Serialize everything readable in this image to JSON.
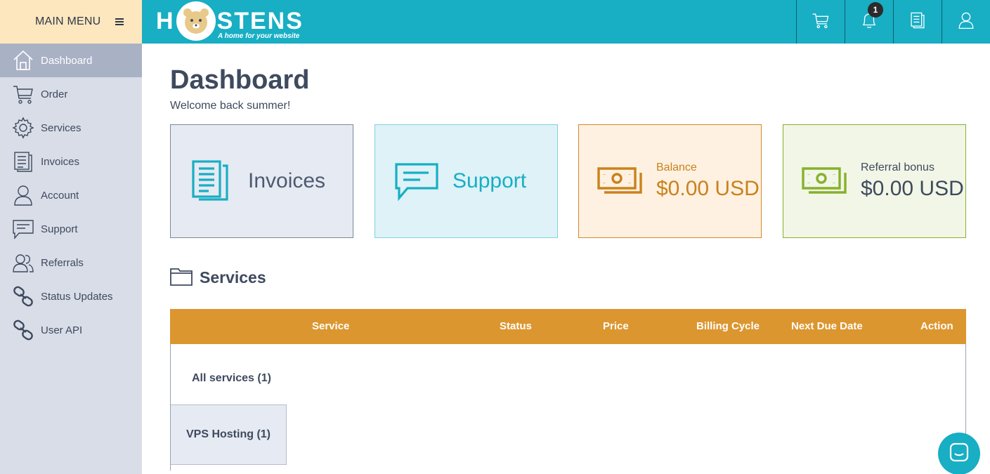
{
  "sidebar": {
    "menu_title": "MAIN MENU",
    "items": [
      {
        "label": "Dashboard",
        "icon": "home-icon",
        "active": true
      },
      {
        "label": "Order",
        "icon": "cart-icon"
      },
      {
        "label": "Services",
        "icon": "gear-icon"
      },
      {
        "label": "Invoices",
        "icon": "invoice-icon"
      },
      {
        "label": "Account",
        "icon": "user-icon"
      },
      {
        "label": "Support",
        "icon": "chat-icon"
      },
      {
        "label": "Referrals",
        "icon": "users-icon"
      },
      {
        "label": "Status Updates",
        "icon": "link-icon"
      },
      {
        "label": "User API",
        "icon": "link-icon"
      }
    ]
  },
  "header": {
    "logo_left": "H",
    "logo_right": "STENS",
    "tagline": "A home for your website",
    "notification_count": "1",
    "icons": [
      "cart-icon",
      "bell-icon",
      "document-icon",
      "user-icon"
    ]
  },
  "main": {
    "title": "Dashboard",
    "welcome": "Welcome back summer!",
    "cards": {
      "invoices": "Invoices",
      "support": "Support",
      "balance_label": "Balance",
      "balance_value": "$0.00 USD",
      "referral_label": "Referral bonus",
      "referral_value": "$0.00 USD"
    },
    "services_title": "Services",
    "table": {
      "columns": [
        "Service",
        "Status",
        "Price",
        "Billing Cycle",
        "Next Due Date",
        "Action"
      ],
      "all_services": "All services (1)",
      "tab": "VPS Hosting (1)"
    }
  },
  "colors": {
    "header": "#18aec4",
    "sidebar": "#d9dde8",
    "menu_head": "#fde7bf",
    "table_head": "#dc962f",
    "balance": "#c9821c",
    "referral": "#86b12d"
  }
}
